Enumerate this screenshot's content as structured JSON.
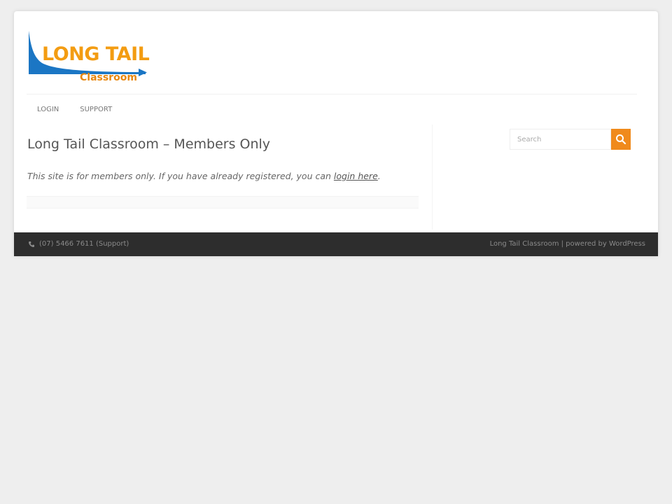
{
  "header": {
    "logo": {
      "main_text": "LONG TAIL",
      "sub_text": "Classroom"
    }
  },
  "nav": {
    "items": [
      {
        "label": "LOGIN"
      },
      {
        "label": "SUPPORT"
      }
    ]
  },
  "main": {
    "title": "Long Tail Classroom – Members Only",
    "notice_prefix": "This site is for members only.  If you have already registered, you can ",
    "notice_link": "login here",
    "notice_suffix": "."
  },
  "search": {
    "placeholder": "Search",
    "icon": "search-icon"
  },
  "footer": {
    "phone_icon": "phone-icon",
    "phone_text": "(07) 5466 7611 (Support)",
    "credit_text": "Long Tail Classroom | powered by WordPress"
  },
  "colors": {
    "accent": "#f08a1c",
    "logo_orange": "#f39c12",
    "logo_blue": "#1b76c4",
    "footer_bg": "#2d2d2d",
    "page_bg": "#eeeeee"
  }
}
